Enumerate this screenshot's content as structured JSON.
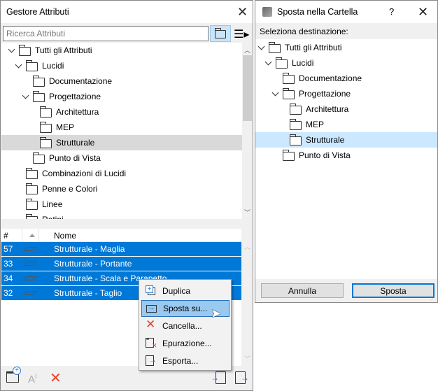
{
  "left_panel": {
    "title": "Gestore Attributi",
    "search_placeholder": "Ricerca Attributi",
    "tree": [
      {
        "label": "Tutti gli Attributi",
        "level": 0,
        "expanded": true,
        "icon": "attributes-folder-icon"
      },
      {
        "label": "Lucidi",
        "level": 1,
        "expanded": true,
        "icon": "layers-folder-icon"
      },
      {
        "label": "Documentazione",
        "level": 2,
        "icon": "folder-icon"
      },
      {
        "label": "Progettazione",
        "level": 2,
        "expanded": true,
        "icon": "folder-icon"
      },
      {
        "label": "Architettura",
        "level": 3,
        "icon": "folder-icon"
      },
      {
        "label": "MEP",
        "level": 3,
        "icon": "folder-icon"
      },
      {
        "label": "Strutturale",
        "level": 3,
        "icon": "folder-icon",
        "selected": true
      },
      {
        "label": "Punto di Vista",
        "level": 2,
        "icon": "folder-icon"
      },
      {
        "label": "Combinazioni di Lucidi",
        "level": 1,
        "icon": "layer-combinations-folder-icon"
      },
      {
        "label": "Penne e Colori",
        "level": 1,
        "icon": "pens-folder-icon"
      },
      {
        "label": "Linee",
        "level": 1,
        "icon": "lines-folder-icon"
      },
      {
        "label": "Retini",
        "level": 1,
        "icon": "fills-folder-icon"
      }
    ],
    "table": {
      "columns": [
        "#",
        "",
        "Nome"
      ],
      "rows": [
        {
          "num": "57",
          "name": "Strutturale - Maglia"
        },
        {
          "num": "33",
          "name": "Strutturale - Portante"
        },
        {
          "num": "34",
          "name": "Strutturale - Scala e Parapetto"
        },
        {
          "num": "32",
          "name": "Strutturale - Taglio"
        }
      ]
    },
    "context_menu": [
      {
        "label": "Duplica",
        "icon": "duplicate-icon"
      },
      {
        "label": "Sposta su...",
        "icon": "move-to-folder-icon",
        "highlighted": true
      },
      {
        "label": "Cancella...",
        "icon": "delete-icon"
      },
      {
        "label": "Epurazione...",
        "icon": "purge-icon"
      },
      {
        "label": "Esporta...",
        "icon": "export-icon"
      }
    ]
  },
  "right_dialog": {
    "title": "Sposta nella Cartella",
    "help": "?",
    "prompt": "Seleziona destinazione:",
    "tree": [
      {
        "label": "Tutti gli Attributi",
        "level": 0,
        "expanded": true
      },
      {
        "label": "Lucidi",
        "level": 1,
        "expanded": true
      },
      {
        "label": "Documentazione",
        "level": 2
      },
      {
        "label": "Progettazione",
        "level": 2,
        "expanded": true
      },
      {
        "label": "Architettura",
        "level": 3
      },
      {
        "label": "MEP",
        "level": 3
      },
      {
        "label": "Strutturale",
        "level": 3,
        "selected": true
      },
      {
        "label": "Punto di Vista",
        "level": 2
      }
    ],
    "cancel_label": "Annulla",
    "ok_label": "Sposta"
  },
  "colors": {
    "selection": "#0078d7",
    "tree_selected": "#d9d9d9",
    "dialog_selected": "#cce8ff",
    "delete_red": "#e8412c",
    "accent_blue": "#2f7fd8"
  }
}
